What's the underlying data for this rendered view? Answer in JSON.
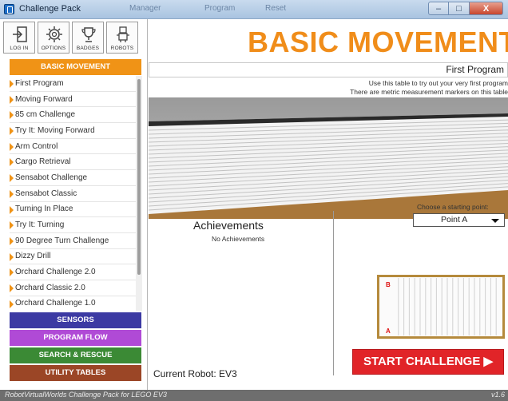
{
  "window": {
    "title": "Challenge Pack",
    "ghost_tabs": [
      "Manager",
      "Program",
      "Reset"
    ],
    "buttons": {
      "minimize": "–",
      "maximize": "□",
      "close": "X"
    }
  },
  "toolbar": {
    "login": "LOG IN",
    "options": "OPTIONS",
    "badges": "BADGES",
    "robots": "ROBOTS"
  },
  "categories": {
    "basic": "BASIC MOVEMENT",
    "sensors": "SENSORS",
    "flow": "PROGRAM FLOW",
    "search": "SEARCH & RESCUE",
    "utility": "UTILITY TABLES"
  },
  "challenges": [
    "First Program",
    "Moving Forward",
    "85 cm Challenge",
    "Try It: Moving Forward",
    "Arm Control",
    "Cargo Retrieval",
    "Sensabot Challenge",
    "Sensabot Classic",
    "Turning In Place",
    "Try It: Turning",
    "90 Degree Turn Challenge",
    "Dizzy Drill",
    "Orchard Challenge 2.0",
    "Orchard Classic 2.0",
    "Orchard Challenge 1.0"
  ],
  "main": {
    "heading": "BASIC MOVEMENT",
    "subtitle": "First Program",
    "desc_line1": "Use this table to try out your very first program",
    "desc_line2": "There are metric measurement markers on this table",
    "achievements_title": "Achievements",
    "achievements_empty": "No Achievements",
    "start_point_label": "Choose a starting point:",
    "start_point_value": "Point A",
    "map_point_b": "B",
    "map_point_a": "A",
    "current_robot": "Current Robot: EV3",
    "start_button": "START CHALLENGE ▶"
  },
  "footer": {
    "brand": "RobotVirtualWorlds Challenge Pack for LEGO EV3",
    "version": "v1.6"
  },
  "colors": {
    "accent_orange": "#f09316",
    "sensors": "#3c3aa3",
    "program_flow": "#b04ad6",
    "search_rescue": "#3b8a35",
    "utility": "#9b4626",
    "start_red": "#e12428"
  }
}
